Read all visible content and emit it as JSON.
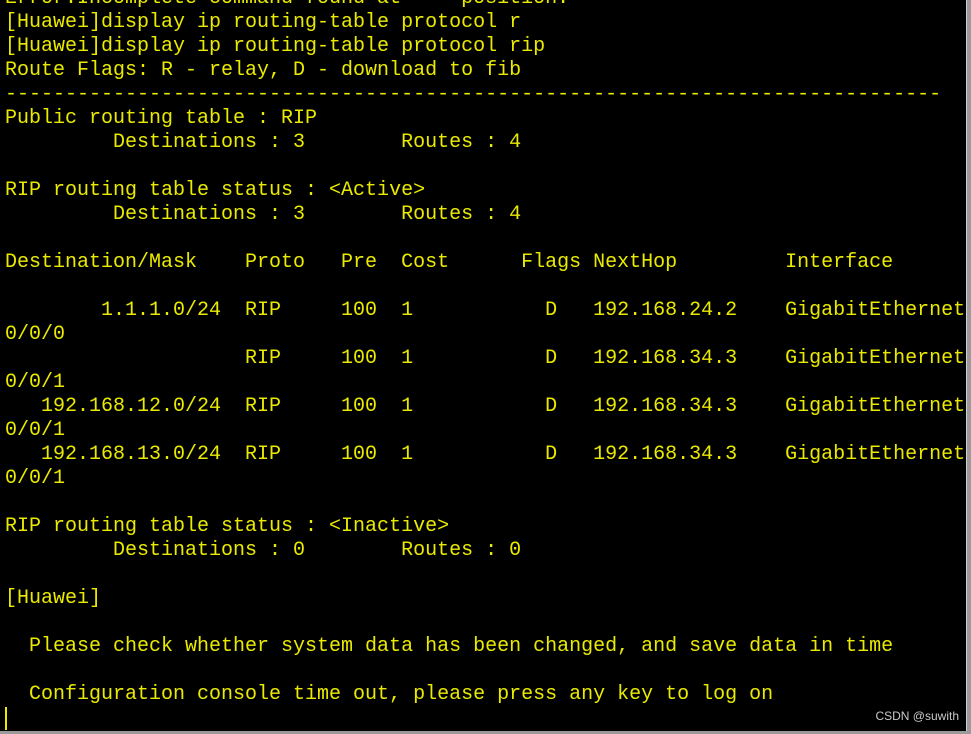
{
  "terminal": {
    "text_color": "#eaea00",
    "background": "#000000",
    "lines": [
      "Error:Incomplete command found at     position.",
      "[Huawei]display ip routing-table protocol r",
      "[Huawei]display ip routing-table protocol rip",
      "Route Flags: R - relay, D - download to fib",
      "------------------------------------------------------------------------------",
      "Public routing table : RIP",
      "         Destinations : 3        Routes : 4",
      "",
      "RIP routing table status : <Active>",
      "         Destinations : 3        Routes : 4",
      "",
      "Destination/Mask    Proto   Pre  Cost      Flags NextHop         Interface",
      "",
      "        1.1.1.0/24  RIP     100  1           D   192.168.24.2    GigabitEthernet",
      "0/0/0",
      "                    RIP     100  1           D   192.168.34.3    GigabitEthernet",
      "0/0/1",
      "   192.168.12.0/24  RIP     100  1           D   192.168.34.3    GigabitEthernet",
      "0/0/1",
      "   192.168.13.0/24  RIP     100  1           D   192.168.34.3    GigabitEthernet",
      "0/0/1",
      "",
      "RIP routing table status : <Inactive>",
      "         Destinations : 0        Routes : 0",
      "",
      "[Huawei]",
      "",
      "  Please check whether system data has been changed, and save data in time",
      "",
      "  Configuration console time out, please press any key to log on"
    ]
  },
  "watermark": "CSDN @suwith"
}
